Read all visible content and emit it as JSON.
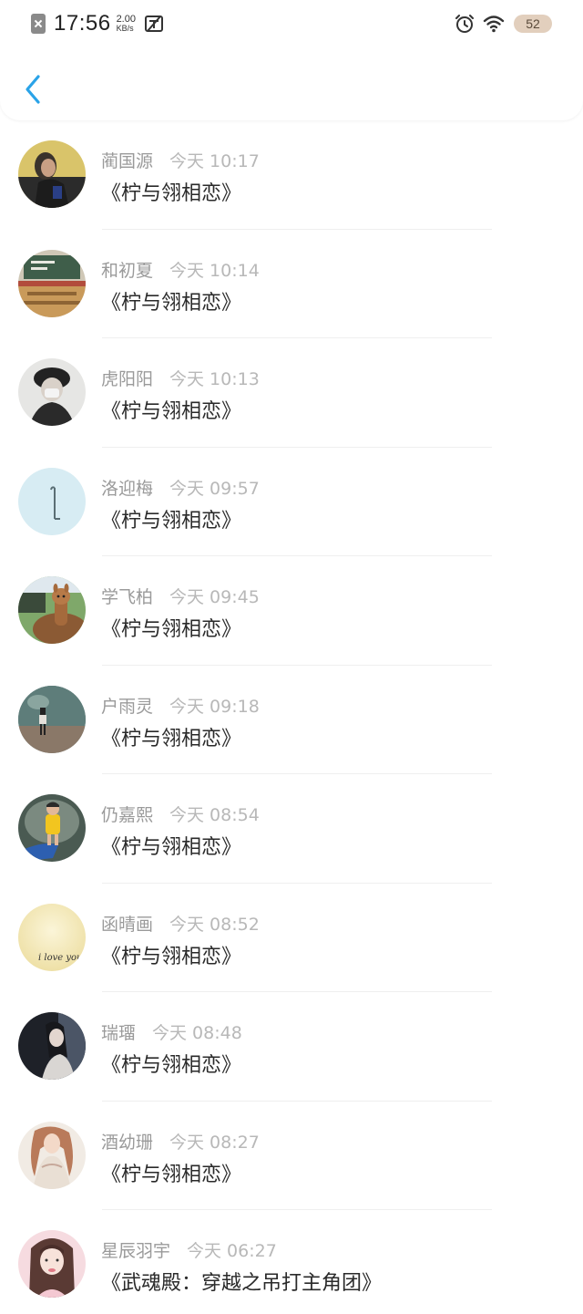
{
  "status_bar": {
    "time": "17:56",
    "net_speed_value": "2.00",
    "net_speed_unit": "KB/s",
    "battery": "52",
    "icons": [
      "sim-off-icon",
      "tsup-icon",
      "alarm-icon",
      "wifi-icon",
      "battery-icon"
    ]
  },
  "header": {
    "back_icon": "chevron-left-icon"
  },
  "items": [
    {
      "name": "蔺国源",
      "time": "今天 10:17",
      "title": "《柠与翎相恋》"
    },
    {
      "name": "和初夏",
      "time": "今天 10:14",
      "title": "《柠与翎相恋》"
    },
    {
      "name": "虎阳阳",
      "time": "今天 10:13",
      "title": "《柠与翎相恋》"
    },
    {
      "name": "洛迎梅",
      "time": "今天 09:57",
      "title": "《柠与翎相恋》"
    },
    {
      "name": "学飞柏",
      "time": "今天 09:45",
      "title": "《柠与翎相恋》"
    },
    {
      "name": "户雨灵",
      "time": "今天 09:18",
      "title": "《柠与翎相恋》"
    },
    {
      "name": "仍嘉熙",
      "time": "今天 08:54",
      "title": "《柠与翎相恋》"
    },
    {
      "name": "函晴画",
      "time": "今天 08:52",
      "title": "《柠与翎相恋》"
    },
    {
      "name": "瑞璢",
      "time": "今天 08:48",
      "title": "《柠与翎相恋》"
    },
    {
      "name": "酒幼珊",
      "time": "今天 08:27",
      "title": "《柠与翎相恋》"
    },
    {
      "name": "星辰羽宇",
      "time": "今天 06:27",
      "title": "《武魂殿：穿越之吊打主角团》"
    }
  ],
  "avatar_art": {
    "row8_text": "i love you"
  },
  "colors": {
    "accent": "#2aa3e8",
    "name_text": "#9a9a9a",
    "time_text": "#b8b8b8",
    "title_text": "#2a2a2a",
    "battery_bg": "#e2cfbd"
  }
}
